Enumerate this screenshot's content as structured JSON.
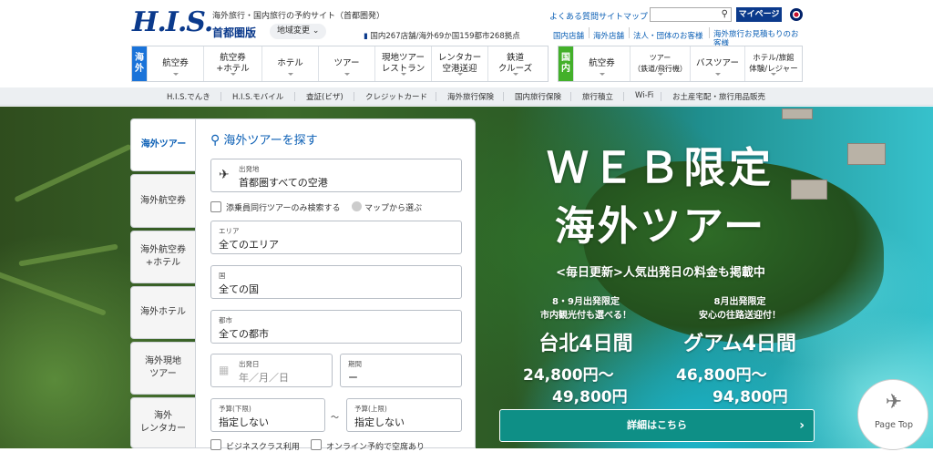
{
  "header": {
    "logo": "H.I.S.",
    "tagline": "海外旅行・国内旅行の予約サイト（首都圏発）",
    "area": "首都圏版",
    "area_change": "地域変更",
    "stats": "国内267店舗/海外69か国159都市268拠点",
    "faq": "よくある質問",
    "sitemap": "サイトマップ",
    "search_placeholder": "",
    "mypage": "マイページ",
    "links": [
      "国内店舗",
      "海外店舗",
      "法人・団体のお客様",
      "海外旅行お見積もりのお客様"
    ]
  },
  "nav_overseas": {
    "label": "海外",
    "items": [
      "航空券",
      "航空券\n+ホテル",
      "ホテル",
      "ツアー",
      "現地ツアー\nレストラン",
      "レンタカー\n空港送迎",
      "鉄道\nクルーズ"
    ]
  },
  "nav_domestic": {
    "label": "国内",
    "items": [
      "航空券",
      "ツアー\n（鉄道/飛行機）",
      "バスツアー",
      "ホテル/旅館\n体験/レジャー"
    ]
  },
  "subnav": [
    "H.I.S.でんき",
    "H.I.S.モバイル",
    "査証(ビザ)",
    "クレジットカード",
    "海外旅行保険",
    "国内旅行保険",
    "旅行積立",
    "Wi-Fi",
    "お土産宅配・旅行用品販売"
  ],
  "search_tabs": [
    "海外ツアー",
    "海外航空券",
    "海外航空券\n+ホテル",
    "海外ホテル",
    "海外現地\nツアー",
    "海外\nレンタカー"
  ],
  "search_panel": {
    "title": "海外ツアーを探す",
    "departure_label": "出発地",
    "departure_value": "首都圏すべての空港",
    "escort_only": "添乗員同行ツアーのみ検索する",
    "map_select": "マップから選ぶ",
    "area_label": "エリア",
    "area_value": "全てのエリア",
    "country_label": "国",
    "country_value": "全ての国",
    "city_label": "都市",
    "city_value": "全ての都市",
    "date_label": "出発日",
    "date_placeholder": "年／月／日",
    "period_label": "期間",
    "period_value": "ー",
    "budget_min_label": "予算(下限)",
    "budget_min_value": "指定しない",
    "budget_tilde": "～",
    "budget_max_label": "予算(上限)",
    "budget_max_value": "指定しない",
    "business_class": "ビジネスクラス利用",
    "online_available": "オンライン予約で空席あり"
  },
  "promo": {
    "line1": "ＷＥＢ限定",
    "line2": "海外ツアー",
    "sub": "<毎日更新>人気出発日の料金も掲載中",
    "deal1_note1": "8・9月出発限定",
    "deal1_note2": "市内観光付も選べる！",
    "deal1_title": "台北4日間",
    "deal1_price1": "24,800円～",
    "deal1_price2": "49,800円",
    "deal2_note1": "8月出発限定",
    "deal2_note2": "安心の往路送迎付！",
    "deal2_title": "グアム4日間",
    "deal2_price1": "46,800円～",
    "deal2_price2": "94,800円",
    "cta": "詳細はこちら"
  },
  "page_top": "Page Top",
  "colors": {
    "brand": "#0b3a8c",
    "overseas": "#1a73d9",
    "domestic": "#43b02a",
    "cta": "#0e8f86"
  }
}
